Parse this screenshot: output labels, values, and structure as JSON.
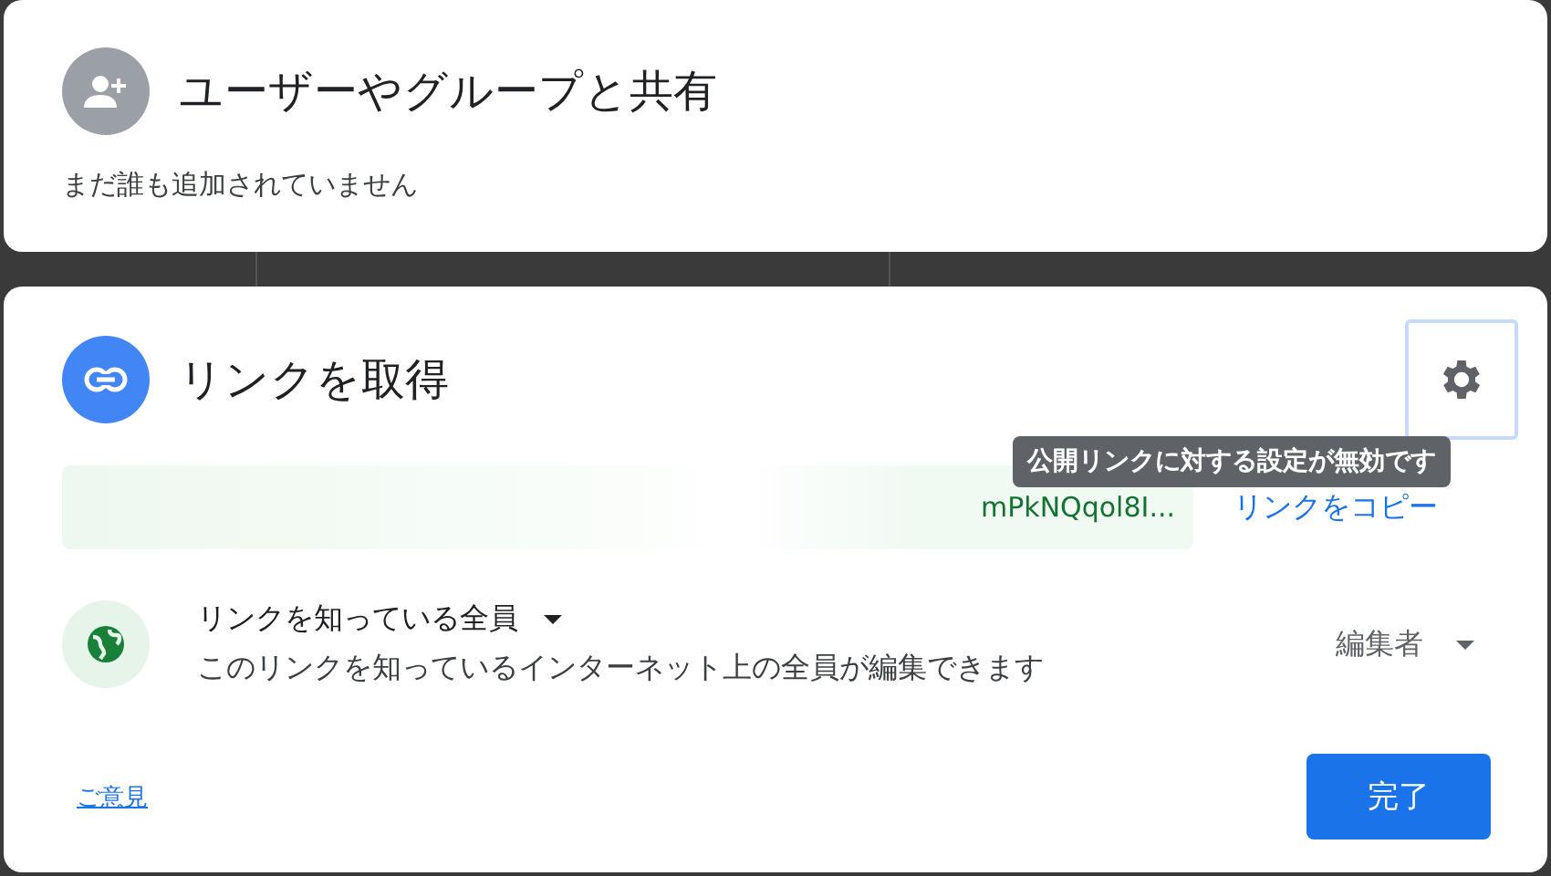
{
  "share_panel": {
    "title": "ユーザーやグループと共有",
    "subtitle": "まだ誰も追加されていません"
  },
  "link_panel": {
    "title": "リンクを取得",
    "settings_tooltip": "公開リンクに対する設定が無効です",
    "link_field": {
      "value": "mPkNQqol8I..."
    },
    "copy_link": "リンクをコピー",
    "access": {
      "scope": "リンクを知っている全員",
      "description": "このリンクを知っているインターネット上の全員が編集できます",
      "role": "編集者"
    },
    "feedback": "ご意見",
    "done_button": "完了"
  }
}
